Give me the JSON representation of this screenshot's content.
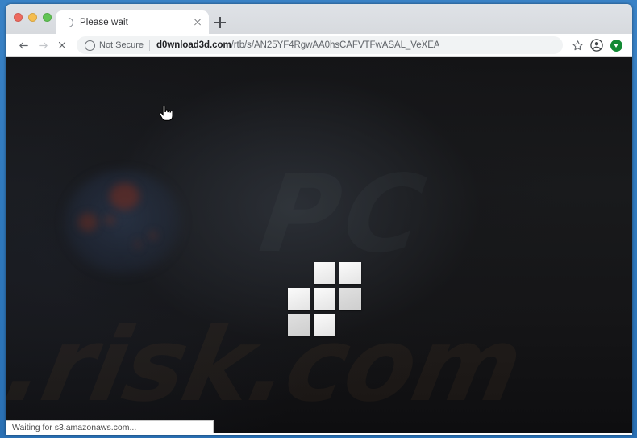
{
  "window": {
    "traffic_lights": [
      {
        "name": "close",
        "color": "#ee6a5f"
      },
      {
        "name": "minimize",
        "color": "#f5bd4f"
      },
      {
        "name": "maximize",
        "color": "#61c454"
      }
    ]
  },
  "tab_strip": {
    "tab": {
      "title": "Please wait",
      "loading_icon": "spinner-icon",
      "close_icon": "close-icon"
    },
    "new_tab_icon": "plus-icon"
  },
  "toolbar": {
    "back_icon": "arrow-left-icon",
    "forward_icon": "arrow-right-icon",
    "stop_icon": "stop-x-icon",
    "omnibox": {
      "security_icon": "info-circle-icon",
      "security_label": "Not Secure",
      "url_host": "d0wnload3d.com",
      "url_path": "/rtb/s/AN25YF4RgwAA0hsCAFVTFwASAL_VeXEA",
      "full_url": "d0wnload3d.com/rtb/s/AN25YF4RgwAA0hsCAFVTFwASAL_VeXEA"
    },
    "bookmark_icon": "star-icon",
    "profile_icon": "account-circle-icon",
    "extension_icon": "download-arrow-icon",
    "extension_color": "#128a34"
  },
  "page": {
    "background_color": "#111112",
    "watermark_top": "PC",
    "watermark_bottom": ".risk.com",
    "loader": {
      "name": "loading-grid-spinner",
      "cells": [
        {
          "row": 0,
          "col": 1,
          "dim": false
        },
        {
          "row": 0,
          "col": 2,
          "dim": false
        },
        {
          "row": 1,
          "col": 0,
          "dim": false
        },
        {
          "row": 1,
          "col": 1,
          "dim": false
        },
        {
          "row": 1,
          "col": 2,
          "dim": true
        },
        {
          "row": 2,
          "col": 0,
          "dim": true
        },
        {
          "row": 2,
          "col": 1,
          "dim": false
        }
      ]
    },
    "cursor": "pointing-hand-cursor"
  },
  "status_bar": {
    "text": "Waiting for s3.amazonaws.com..."
  }
}
